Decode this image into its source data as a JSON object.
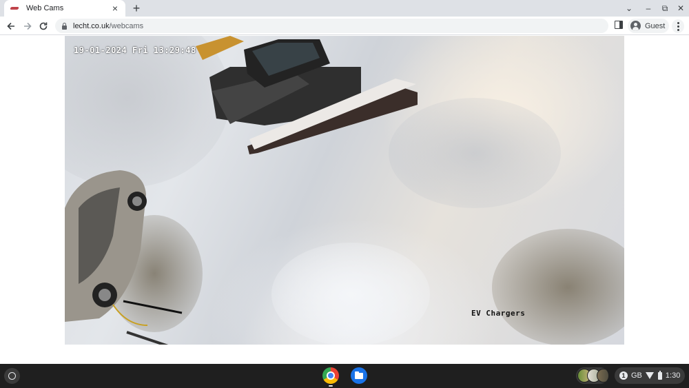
{
  "browser": {
    "tab": {
      "title": "Web Cams",
      "close_glyph": "×"
    },
    "new_tab_glyph": "+",
    "url": {
      "domain": "lecht.co.uk",
      "path": "/webcams"
    },
    "profile": {
      "name": "Guest"
    },
    "window_controls": [
      "⌄",
      "–",
      "⧉",
      "✕"
    ]
  },
  "webcam": {
    "timestamp": "19-01-2024 Fri 13:29:48",
    "label": "EV Chargers"
  },
  "shelf": {
    "apps": [
      "chrome-icon",
      "files-icon"
    ],
    "status": {
      "notification_count": "1",
      "region": "GB",
      "time": "1:30"
    }
  },
  "colors": {
    "tabstrip": "#dee1e6",
    "omnibox": "#f1f3f4",
    "shelf": "#1f1f1f",
    "snow": "#e3e6ea"
  }
}
